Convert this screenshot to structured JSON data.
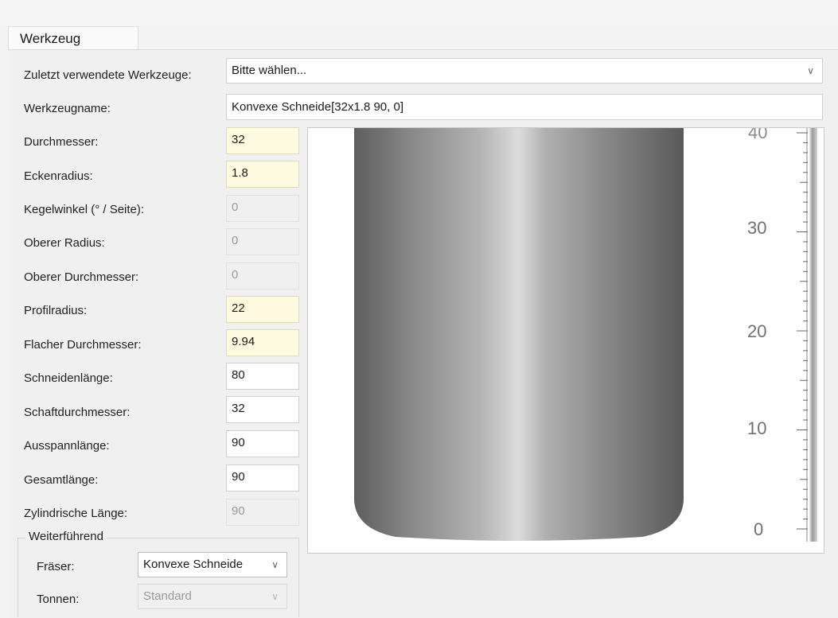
{
  "tab": "Werkzeug",
  "recent_tools": {
    "label": "Zuletzt verwendete Werkzeuge:",
    "value": "Bitte wählen..."
  },
  "tool_name": {
    "label": "Werkzeugname:",
    "value": "Konvexe Schneide[32x1.8 90, 0]"
  },
  "params": [
    {
      "label": "Durchmesser:",
      "value": "32"
    },
    {
      "label": "Eckenradius:",
      "value": "1.8"
    },
    {
      "label": "Kegelwinkel (° / Seite):",
      "value": "0"
    },
    {
      "label": "Oberer Radius:",
      "value": "0"
    },
    {
      "label": "Oberer Durchmesser:",
      "value": "0"
    },
    {
      "label": "Profilradius:",
      "value": "22"
    },
    {
      "label": "Flacher Durchmesser:",
      "value": "9.94"
    },
    {
      "label": "Schneidenlänge:",
      "value": "80"
    },
    {
      "label": "Schaftdurchmesser:",
      "value": "32"
    },
    {
      "label": "Ausspannlänge:",
      "value": "90"
    },
    {
      "label": "Gesamtlänge:",
      "value": "90"
    },
    {
      "label": "Zylindrische Länge:",
      "value": "90"
    }
  ],
  "advanced": {
    "title": "Weiterführend",
    "cutter_label": "Fräser:",
    "cutter_value": "Konvexe Schneide",
    "barrel_label": "Tonnen:",
    "barrel_value": "Standard"
  },
  "ruler": {
    "labels": [
      "30",
      "20",
      "10",
      "0"
    ],
    "top_partial": "40"
  },
  "icons": {
    "dropdown": "chevron-down-icon"
  }
}
